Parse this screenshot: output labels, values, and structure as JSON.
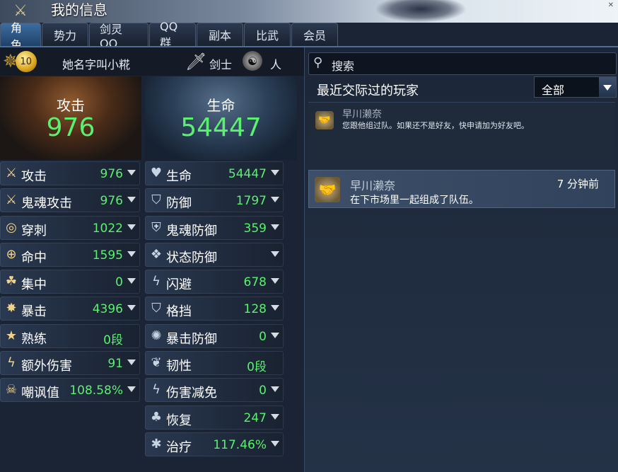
{
  "window": {
    "title": "我的信息"
  },
  "tabs": [
    {
      "label": "角色",
      "active": true
    },
    {
      "label": "势力"
    },
    {
      "label": "剑灵 QQ"
    },
    {
      "label": "QQ群"
    },
    {
      "label": "副本"
    },
    {
      "label": "比武"
    },
    {
      "label": "会员"
    }
  ],
  "character": {
    "level": "10",
    "name": "她名字叫小糀",
    "class": "剑士",
    "race": "人"
  },
  "summary": {
    "attack_label": "攻击",
    "attack_value": "976",
    "health_label": "生命",
    "health_value": "54447"
  },
  "stats_left": [
    {
      "icon": "crossed-swords-icon",
      "label": "攻击",
      "value": "976",
      "expandable": true
    },
    {
      "icon": "ghost-sword-icon",
      "label": "鬼魂攻击",
      "value": "976",
      "expandable": true
    },
    {
      "icon": "pierce-icon",
      "label": "穿刺",
      "value": "1022",
      "expandable": true
    },
    {
      "icon": "target-icon",
      "label": "命中",
      "value": "1595",
      "expandable": true
    },
    {
      "icon": "focus-icon",
      "label": "集中",
      "value": "0",
      "expandable": true
    },
    {
      "icon": "critical-burst-icon",
      "label": "暴击",
      "value": "4396",
      "expandable": true
    },
    {
      "icon": "star-icon",
      "label": "熟练",
      "value": "0段",
      "expandable": false
    },
    {
      "icon": "lightning-icon",
      "label": "额外伤害",
      "value": "91",
      "expandable": true
    },
    {
      "icon": "skull-icon",
      "label": "嘲讽值",
      "value": "108.58%",
      "expandable": true
    }
  ],
  "stats_right": [
    {
      "icon": "heart-icon",
      "label": "生命",
      "value": "54447",
      "expandable": true
    },
    {
      "icon": "shield-icon",
      "label": "防御",
      "value": "1797",
      "expandable": true
    },
    {
      "icon": "ghost-shield-icon",
      "label": "鬼魂防御",
      "value": "359",
      "expandable": true
    },
    {
      "icon": "status-shield-icon",
      "label": "状态防御",
      "value": "",
      "expandable": true
    },
    {
      "icon": "evade-icon",
      "label": "闪避",
      "value": "678",
      "expandable": true
    },
    {
      "icon": "block-icon",
      "label": "格挡",
      "value": "128",
      "expandable": true
    },
    {
      "icon": "crit-defense-icon",
      "label": "暴击防御",
      "value": "0",
      "expandable": true
    },
    {
      "icon": "tenacity-icon",
      "label": "韧性",
      "value": "0段",
      "expandable": false
    },
    {
      "icon": "damage-reduction-icon",
      "label": "伤害减免",
      "value": "0",
      "expandable": true
    },
    {
      "icon": "sprout-icon",
      "label": "恢复",
      "value": "247",
      "expandable": true
    },
    {
      "icon": "heal-icon",
      "label": "治疗",
      "value": "117.46%",
      "expandable": true
    }
  ],
  "social": {
    "search_label": "搜索",
    "recent_title": "最近交际过的玩家",
    "filter_selected": "全部",
    "recent_player": {
      "name": "早川濑奈",
      "description": "您跟他组过队。如果还不是好友，快申请加为好友吧。"
    },
    "log": {
      "name": "早川濑奈",
      "time": "7 分钟前",
      "message": "在下市场里一起组成了队伍。"
    }
  },
  "colors": {
    "value_green": "#5cf070",
    "tab_active": "#3c6ea0",
    "panel_bg": "#1b2434"
  }
}
